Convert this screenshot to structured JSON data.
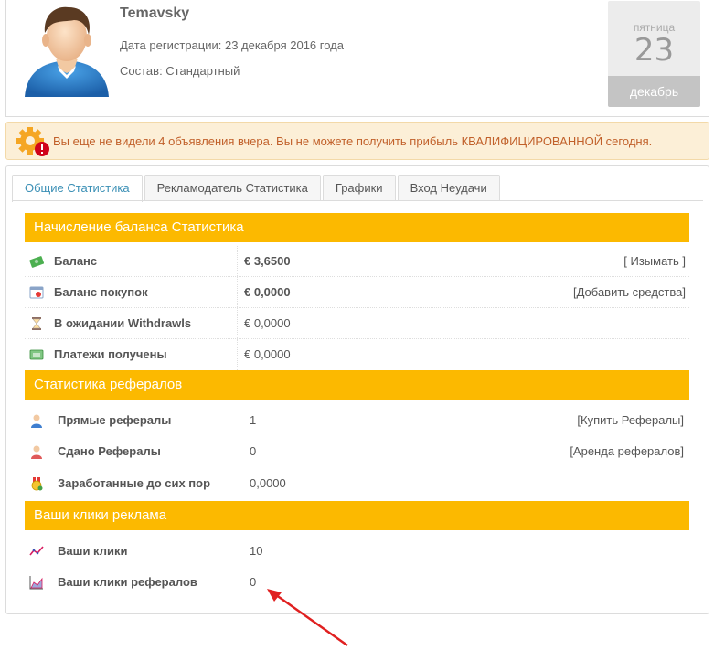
{
  "profile": {
    "username": "Temavsky",
    "registration": "Дата регистрации: 23 декабря 2016 года",
    "membership": "Состав: Стандартный"
  },
  "calendar": {
    "weekday": "пятница",
    "day": "23",
    "month": "декабрь"
  },
  "alert": {
    "text": "Вы еще не видели 4 объявления вчера. Вы не можете получить прибыль КВАЛИФИЦИРОВАННОЙ сегодня.",
    "icon": "gear-warning-icon"
  },
  "tabs": [
    {
      "label": "Общие Статистика",
      "active": true
    },
    {
      "label": "Рекламодатель Статистика",
      "active": false
    },
    {
      "label": "Графики",
      "active": false
    },
    {
      "label": "Вход Неудачи",
      "active": false
    }
  ],
  "balance_section": {
    "title": "Начисление баланса Статистика",
    "rows": [
      {
        "label": "Баланс",
        "value": "€ 3,6500",
        "action": "[ Изымать ]",
        "icon": "money-icon"
      },
      {
        "label": "Баланс покупок",
        "value": "€ 0,0000",
        "action": "[Добавить средства]",
        "icon": "cart-calendar-icon"
      },
      {
        "label": "В ожидании Withdrawls",
        "value": "€ 0,0000",
        "action": "",
        "icon": "hourglass-icon"
      },
      {
        "label": "Платежи получены",
        "value": "€ 0,0000",
        "action": "",
        "icon": "cash-received-icon"
      }
    ]
  },
  "referral_section": {
    "title": "Статистика рефералов",
    "rows": [
      {
        "label": "Прямые рефералы",
        "value": "1",
        "action": "[Купить Рефералы]",
        "icon": "user-blue-icon"
      },
      {
        "label": "Сдано Рефералы",
        "value": "0",
        "action": "[Аренда рефералов]",
        "icon": "user-red-icon"
      },
      {
        "label": "Заработанные до сих пор",
        "value": "0,0000",
        "action": "",
        "icon": "medal-icon"
      }
    ]
  },
  "clicks_section": {
    "title": "Ваши клики реклама",
    "rows": [
      {
        "label": "Ваши клики",
        "value": "10",
        "icon": "line-chart-icon"
      },
      {
        "label": "Ваши клики рефералов",
        "value": "0",
        "icon": "area-chart-icon"
      }
    ]
  },
  "colors": {
    "section_header": "#fcb900",
    "alert_bg": "#fcefd7",
    "alert_text": "#c1602a",
    "active_tab": "#3a8fb5",
    "arrow": "#e02020"
  }
}
